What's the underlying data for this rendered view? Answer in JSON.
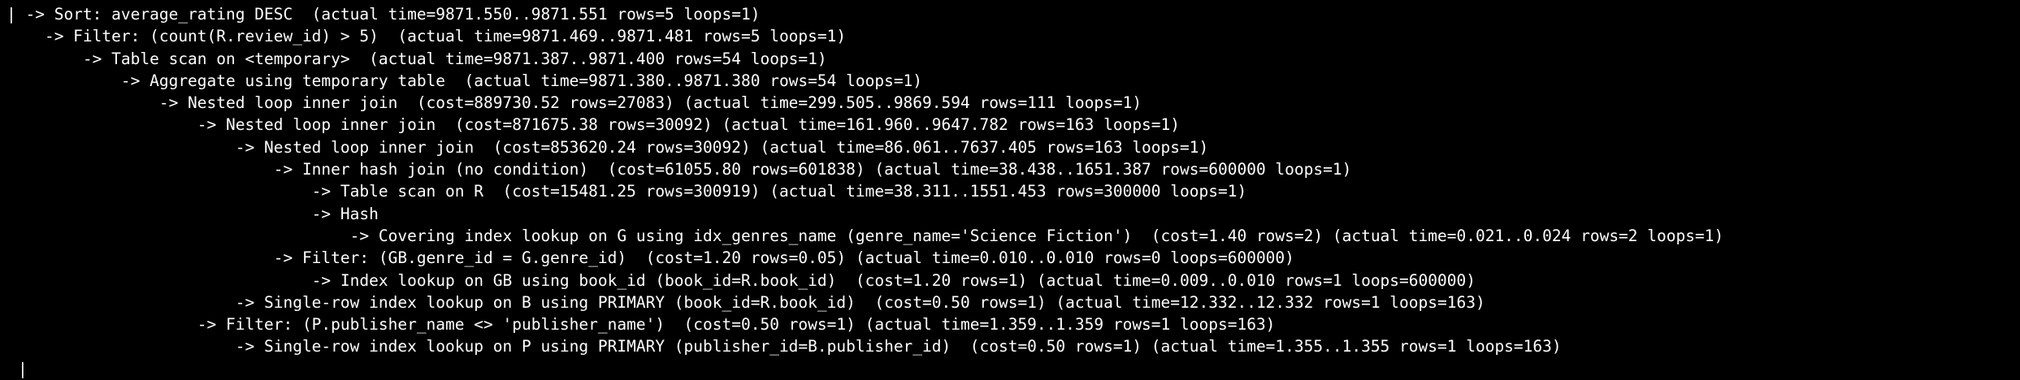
{
  "terminal": {
    "lines": [
      "| -> Sort: average_rating DESC  (actual time=9871.550..9871.551 rows=5 loops=1)",
      "    -> Filter: (count(R.review_id) > 5)  (actual time=9871.469..9871.481 rows=5 loops=1)",
      "        -> Table scan on <temporary>  (actual time=9871.387..9871.400 rows=54 loops=1)",
      "            -> Aggregate using temporary table  (actual time=9871.380..9871.380 rows=54 loops=1)",
      "                -> Nested loop inner join  (cost=889730.52 rows=27083) (actual time=299.505..9869.594 rows=111 loops=1)",
      "                    -> Nested loop inner join  (cost=871675.38 rows=30092) (actual time=161.960..9647.782 rows=163 loops=1)",
      "                        -> Nested loop inner join  (cost=853620.24 rows=30092) (actual time=86.061..7637.405 rows=163 loops=1)",
      "                            -> Inner hash join (no condition)  (cost=61055.80 rows=601838) (actual time=38.438..1651.387 rows=600000 loops=1)",
      "                                -> Table scan on R  (cost=15481.25 rows=300919) (actual time=38.311..1551.453 rows=300000 loops=1)",
      "                                -> Hash",
      "                                    -> Covering index lookup on G using idx_genres_name (genre_name='Science Fiction')  (cost=1.40 rows=2) (actual time=0.021..0.024 rows=2 loops=1)",
      "                            -> Filter: (GB.genre_id = G.genre_id)  (cost=1.20 rows=0.05) (actual time=0.010..0.010 rows=0 loops=600000)",
      "                                -> Index lookup on GB using book_id (book_id=R.book_id)  (cost=1.20 rows=1) (actual time=0.009..0.010 rows=1 loops=600000)",
      "                        -> Single-row index lookup on B using PRIMARY (book_id=R.book_id)  (cost=0.50 rows=1) (actual time=12.332..12.332 rows=1 loops=163)",
      "                    -> Filter: (P.publisher_name <> 'publisher_name')  (cost=0.50 rows=1) (actual time=1.359..1.359 rows=1 loops=163)",
      "                        -> Single-row index lookup on P using PRIMARY (publisher_id=B.publisher_id)  (cost=0.50 rows=1) (actual time=1.355..1.355 rows=1 loops=163)"
    ],
    "prompt": "|"
  },
  "colors": {
    "background": "#000000",
    "text": "#ffffff"
  }
}
